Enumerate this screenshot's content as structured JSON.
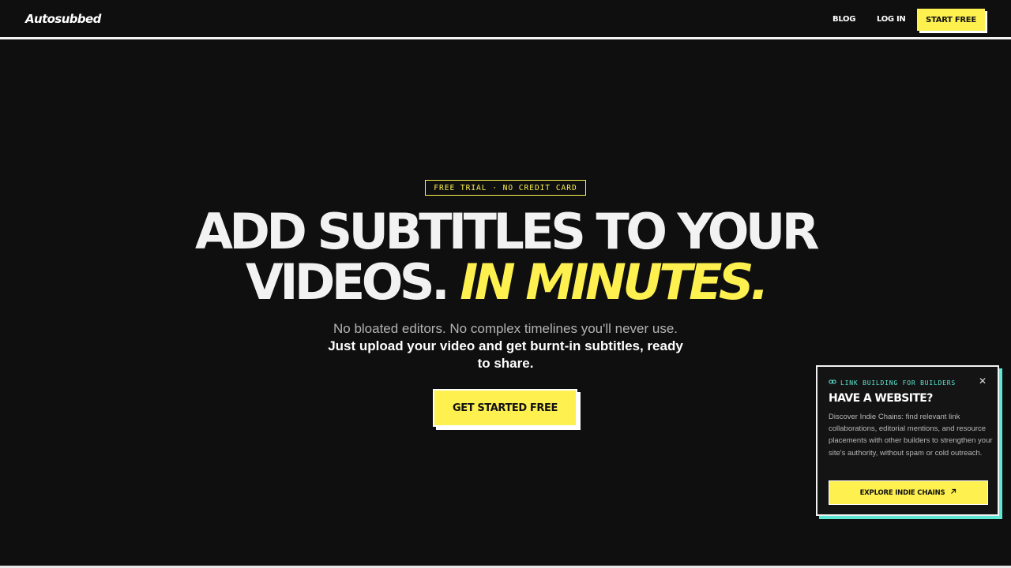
{
  "header": {
    "logo": "Autosubbed",
    "nav": {
      "blog": "BLOG",
      "login": "LOG IN"
    },
    "start_button": "START FREE"
  },
  "hero": {
    "badge": "FREE TRIAL · NO CREDIT CARD",
    "headline_line1": "ADD SUBTITLES TO YOUR",
    "headline_line2_plain": "VIDEOS.",
    "headline_line2_accent": "IN MINUTES.",
    "sub_light": "No bloated editors. No complex timelines you'll never use.",
    "sub_bold": "Just upload your video and get burnt-in subtitles, ready to share.",
    "cta": "GET STARTED FREE"
  },
  "popup": {
    "eyebrow": "LINK BUILDING FOR BUILDERS",
    "eyebrow_icon": "link-icon",
    "title": "HAVE A WEBSITE?",
    "body": "Discover Indie Chains: find relevant link collaborations, editorial mentions, and resource placements with other builders to strengthen your site's authority, without spam or cold outreach.",
    "button": "EXPLORE INDIE CHAINS",
    "button_icon": "arrow-up-right-icon",
    "close_icon": "close-icon"
  },
  "colors": {
    "background": "#0f0f10",
    "accent_yellow": "#fdf04f",
    "accent_teal": "#5de8d6",
    "text": "#f2f2f2"
  }
}
